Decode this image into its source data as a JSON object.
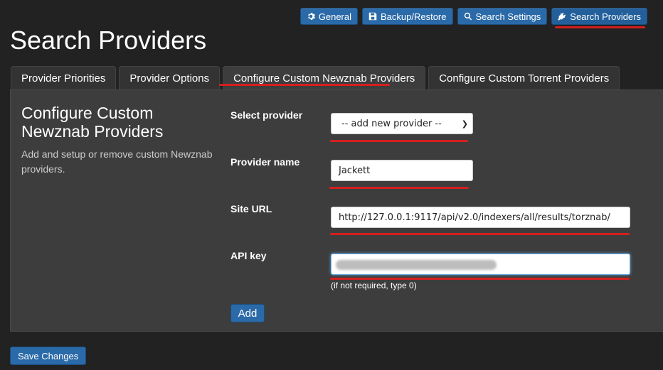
{
  "toolbar": {
    "buttons": [
      {
        "label": "General",
        "icon": "gear-icon"
      },
      {
        "label": "Backup/Restore",
        "icon": "save-icon"
      },
      {
        "label": "Search Settings",
        "icon": "search-icon"
      },
      {
        "label": "Search Providers",
        "icon": "plug-icon"
      }
    ],
    "active": "Search Providers"
  },
  "page": {
    "title": "Search Providers"
  },
  "tabs": [
    {
      "label": "Provider Priorities"
    },
    {
      "label": "Provider Options"
    },
    {
      "label": "Configure Custom Newznab Providers"
    },
    {
      "label": "Configure Custom Torrent Providers"
    }
  ],
  "active_tab": "Configure Custom Newznab Providers",
  "section": {
    "title": "Configure Custom Newznab Providers",
    "description": "Add and setup or remove custom Newznab providers."
  },
  "form": {
    "select_provider": {
      "label": "Select provider",
      "value": "-- add new provider --"
    },
    "provider_name": {
      "label": "Provider name",
      "value": "Jackett"
    },
    "site_url": {
      "label": "Site URL",
      "value": "http://127.0.0.1:9117/api/v2.0/indexers/all/results/torznab/"
    },
    "api_key": {
      "label": "API key",
      "hint": "(if not required, type 0)"
    },
    "add_label": "Add"
  },
  "footer": {
    "save_label": "Save Changes"
  },
  "colors": {
    "accent": "#2b6aa8",
    "highlight": "#d41f1f",
    "background": "#222222",
    "panel": "#3d3d3d"
  }
}
